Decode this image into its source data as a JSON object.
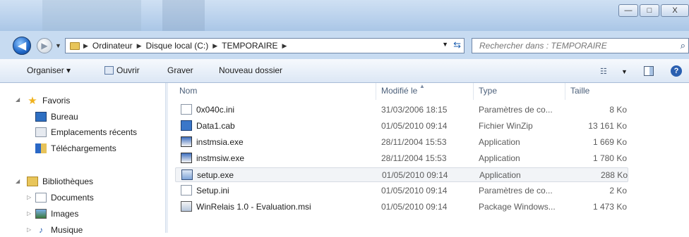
{
  "window": {
    "minimize": "—",
    "maximize": "□",
    "close": "X"
  },
  "address": {
    "crumbs": [
      "Ordinateur",
      "Disque local (C:)",
      "TEMPORAIRE"
    ],
    "search_placeholder": "Rechercher dans : TEMPORAIRE"
  },
  "toolbar": {
    "organize": "Organiser ▾",
    "open": "Ouvrir",
    "burn": "Graver",
    "new_folder": "Nouveau dossier"
  },
  "sidebar": {
    "favorites": "Favoris",
    "desktop": "Bureau",
    "recent": "Emplacements récents",
    "downloads": "Téléchargements",
    "libraries": "Bibliothèques",
    "documents": "Documents",
    "images": "Images",
    "music": "Musique"
  },
  "columns": {
    "name": "Nom",
    "modified": "Modifié le",
    "type": "Type",
    "size": "Taille"
  },
  "files": [
    {
      "name": "0x040c.ini",
      "modified": "31/03/2006 18:15",
      "type": "Paramètres de co...",
      "size": "8 Ko",
      "icon": "ini-file-icon"
    },
    {
      "name": "Data1.cab",
      "modified": "01/05/2010 09:14",
      "type": "Fichier WinZip",
      "size": "13 161 Ko",
      "icon": "cab-file-icon"
    },
    {
      "name": "instmsia.exe",
      "modified": "28/11/2004 15:53",
      "type": "Application",
      "size": "1 669 Ko",
      "icon": "exe-file-icon"
    },
    {
      "name": "instmsiw.exe",
      "modified": "28/11/2004 15:53",
      "type": "Application",
      "size": "1 780 Ko",
      "icon": "exe-file-icon"
    },
    {
      "name": "setup.exe",
      "modified": "01/05/2010 09:14",
      "type": "Application",
      "size": "288 Ko",
      "icon": "setup-exe-icon",
      "selected": true
    },
    {
      "name": "Setup.ini",
      "modified": "01/05/2010 09:14",
      "type": "Paramètres de co...",
      "size": "2 Ko",
      "icon": "ini-file-icon"
    },
    {
      "name": "WinRelais 1.0 - Evaluation.msi",
      "modified": "01/05/2010 09:14",
      "type": "Package Windows...",
      "size": "1 473 Ko",
      "icon": "msi-file-icon"
    }
  ],
  "colors": {
    "title_bar": "#b9d1ec",
    "selection": "#f2f4f7",
    "header_text": "#4c607a"
  }
}
